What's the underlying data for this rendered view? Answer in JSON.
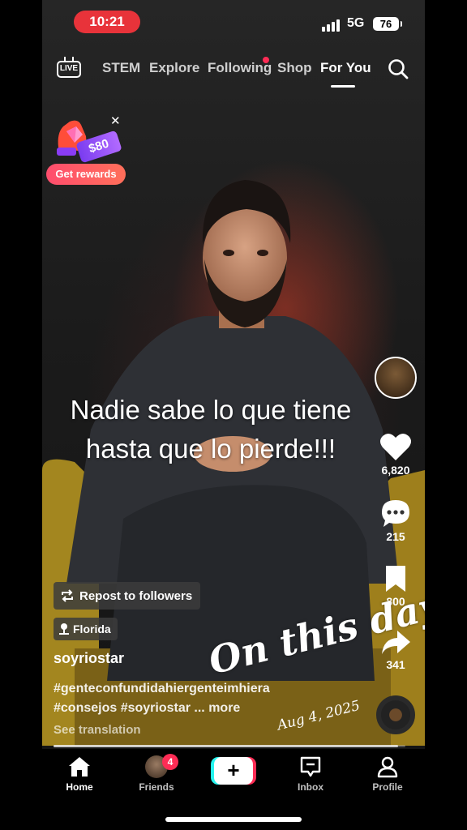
{
  "status_bar": {
    "time": "10:21",
    "network": "5G",
    "battery": "76"
  },
  "top_nav": {
    "live_label": "LIVE",
    "tabs": [
      "STEM",
      "Explore",
      "Following",
      "Shop",
      "For You"
    ],
    "active_tab": "For You"
  },
  "rewards": {
    "amount": "$80",
    "button_label": "Get rewards"
  },
  "video": {
    "overlay_lines": [
      "Nadie sabe lo que tiene",
      "hasta que lo pierde!!!"
    ],
    "likes": "6,820",
    "comments": "215",
    "saves": "800",
    "shares": "341",
    "repost_label": "Repost to followers",
    "location": "Florida",
    "username": "soyriostar",
    "description_lines": [
      "#genteconfundidahiergenteimhiera",
      "#consejos #soyriostar ... more"
    ],
    "see_translation": "See translation",
    "progress": 0.98
  },
  "memory_sticker": {
    "title": "On this day",
    "date": "Aug 4, 2025"
  },
  "bottom_nav": {
    "home": "Home",
    "friends": "Friends",
    "friends_badge": "4",
    "create": "+",
    "inbox": "Inbox",
    "profile": "Profile"
  },
  "colors": {
    "accent": "#fe2c55",
    "status_pill": "#e8333a",
    "cyan": "#25f4ee"
  }
}
